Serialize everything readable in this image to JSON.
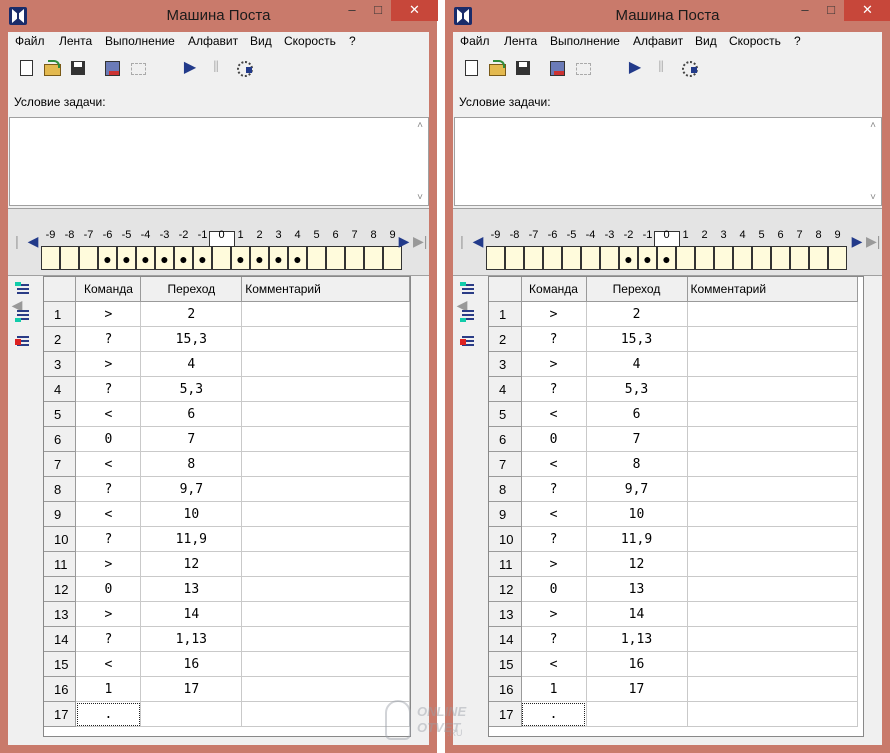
{
  "window": {
    "title": "Машина Поста",
    "close_glyph": "✕",
    "minimize_glyph": "–",
    "maximize_glyph": "□"
  },
  "menu": [
    "Файл",
    "Лента",
    "Выполнение",
    "Алфавит",
    "Вид",
    "Скорость",
    "?"
  ],
  "toolbar_icons": [
    "new-file-icon",
    "open-file-icon",
    "save-icon",
    "library-icon",
    "disabled-icon",
    "run-icon",
    "pause-icon",
    "step-icon"
  ],
  "toolbar_glyphs": {
    "run": "▶",
    "pause": "‖"
  },
  "task": {
    "label": "Условие задачи:",
    "text": ""
  },
  "tape": {
    "labels": [
      "-9",
      "-8",
      "-7",
      "-6",
      "-5",
      "-4",
      "-3",
      "-2",
      "-1",
      "0",
      "1",
      "2",
      "3",
      "4",
      "5",
      "6",
      "7",
      "8",
      "9"
    ],
    "head_position": 0,
    "nav_glyphs": {
      "first": "|◀",
      "prev": "◀",
      "next": "▶",
      "last": "▶|"
    }
  },
  "tape_left": {
    "marked": [
      -6,
      -5,
      -4,
      -3,
      -2,
      -1,
      1,
      2,
      3,
      4
    ]
  },
  "tape_right": {
    "marked": [
      -2,
      -1,
      0
    ]
  },
  "mark_glyph": "●",
  "scroll_glyphs": {
    "up": "˄",
    "down": "˅"
  },
  "table": {
    "headers": [
      "Команда",
      "Переход",
      "Комментарий"
    ],
    "rows": [
      {
        "n": "1",
        "cmd": ">",
        "jump": "2"
      },
      {
        "n": "2",
        "cmd": "?",
        "jump": "15,3"
      },
      {
        "n": "3",
        "cmd": ">",
        "jump": "4"
      },
      {
        "n": "4",
        "cmd": "?",
        "jump": "5,3"
      },
      {
        "n": "5",
        "cmd": "<",
        "jump": "6"
      },
      {
        "n": "6",
        "cmd": "0",
        "jump": "7"
      },
      {
        "n": "7",
        "cmd": "<",
        "jump": "8"
      },
      {
        "n": "8",
        "cmd": "?",
        "jump": "9,7"
      },
      {
        "n": "9",
        "cmd": "<",
        "jump": "10"
      },
      {
        "n": "10",
        "cmd": "?",
        "jump": "11,9"
      },
      {
        "n": "11",
        "cmd": ">",
        "jump": "12"
      },
      {
        "n": "12",
        "cmd": "0",
        "jump": "13"
      },
      {
        "n": "13",
        "cmd": ">",
        "jump": "14"
      },
      {
        "n": "14",
        "cmd": "?",
        "jump": "1,13"
      },
      {
        "n": "15",
        "cmd": "<",
        "jump": "16"
      },
      {
        "n": "16",
        "cmd": "1",
        "jump": "17"
      },
      {
        "n": "17",
        "cmd": ".",
        "jump": ""
      }
    ]
  },
  "watermark": {
    "line1": "ONLINE",
    "line2": "OTVET",
    "suffix": ".RU"
  }
}
